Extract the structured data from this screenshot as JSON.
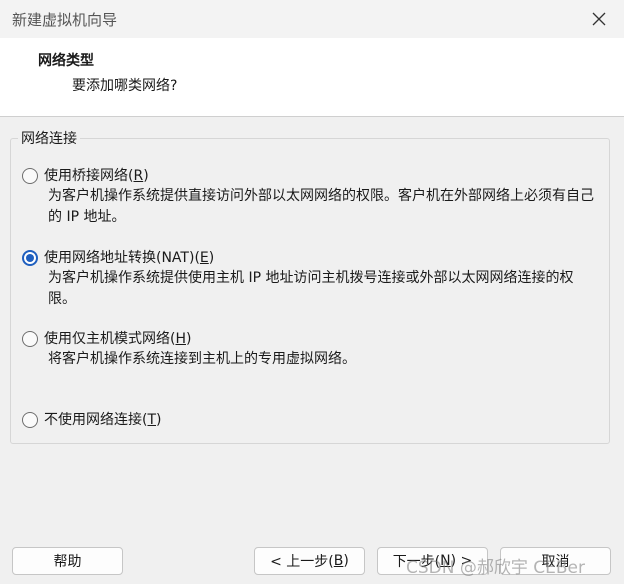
{
  "window": {
    "title": "新建虚拟机向导"
  },
  "header": {
    "title": "网络类型",
    "subtitle": "要添加哪类网络?"
  },
  "group": {
    "legend": "网络连接"
  },
  "options": [
    {
      "label_pre": "使用桥接网络(",
      "hotkey": "R",
      "label_post": ")",
      "checked": false,
      "desc": "为客户机操作系统提供直接访问外部以太网网络的权限。客户机在外部网络上必须有自己的 IP 地址。"
    },
    {
      "label_pre": "使用网络地址转换(NAT)(",
      "hotkey": "E",
      "label_post": ")",
      "checked": true,
      "desc": "为客户机操作系统提供使用主机 IP 地址访问主机拨号连接或外部以太网网络连接的权限。"
    },
    {
      "label_pre": "使用仅主机模式网络(",
      "hotkey": "H",
      "label_post": ")",
      "checked": false,
      "desc": "将客户机操作系统连接到主机上的专用虚拟网络。"
    },
    {
      "label_pre": "不使用网络连接(",
      "hotkey": "T",
      "label_post": ")",
      "checked": false,
      "desc": ""
    }
  ],
  "buttons": {
    "help": "帮助",
    "back_pre": "< 上一步(",
    "back_hotkey": "B",
    "back_post": ")",
    "next_pre": "下一步(",
    "next_hotkey": "N",
    "next_post": ") >",
    "cancel": "取消"
  },
  "watermark": "CSDN @郝欣宇 CEBer"
}
